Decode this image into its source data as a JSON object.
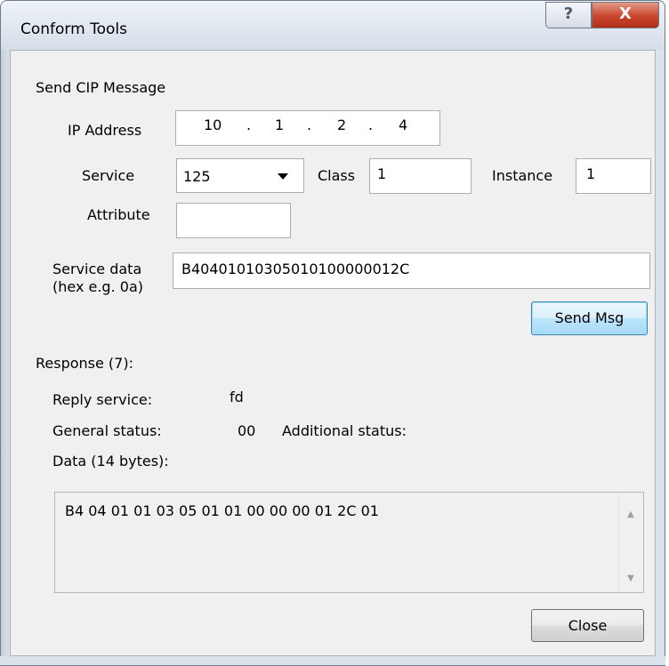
{
  "window": {
    "title": "Conform Tools",
    "help_glyph": "?",
    "close_glyph": "X"
  },
  "send": {
    "heading": "Send CIP Message",
    "ip_label": "IP Address",
    "ip": [
      "10",
      ".",
      "1",
      ".",
      "2",
      ".",
      "4"
    ],
    "service_label": "Service",
    "service_value": "125",
    "class_label": "Class",
    "class_value": "1",
    "instance_label": "Instance",
    "instance_value": "1",
    "attribute_label": "Attribute",
    "attribute_value": "",
    "data_label_1": "Service data",
    "data_label_2": "(hex e.g. 0a)",
    "data_value": "B40401010305010100000012C",
    "send_button": "Send Msg"
  },
  "response": {
    "heading": "Response (7):",
    "reply_service_label": "Reply service:",
    "reply_service_value": "fd",
    "general_status_label": "General status:",
    "general_status_value": "00",
    "additional_status_label": "Additional status:",
    "data_label": "Data (14 bytes):",
    "data_value": "B4 04 01 01 03 05 01 01 00 00 00 01 2C 01"
  },
  "close_button": "Close",
  "icons": {
    "dropdown": "chevron-down-icon",
    "scroll_up": "scroll-up-arrow-icon",
    "scroll_down": "scroll-down-arrow-icon"
  }
}
